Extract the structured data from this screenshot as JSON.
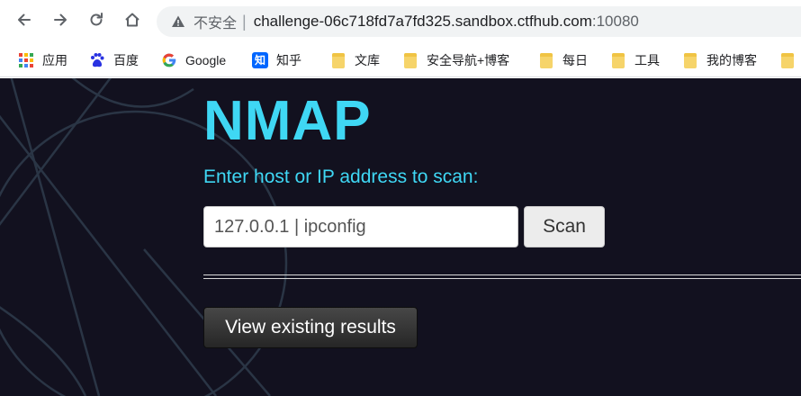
{
  "browser": {
    "nav": {
      "back_icon": "arrow-left-icon",
      "forward_icon": "arrow-right-icon",
      "reload_icon": "reload-icon",
      "home_icon": "home-icon"
    },
    "omnibox": {
      "security_icon": "warning-triangle-icon",
      "security_label": "不安全",
      "separator": "|",
      "url_host": "challenge-06c718fd7a7fd325.sandbox.ctfhub.com",
      "url_port": ":10080"
    },
    "bookmarks": [
      {
        "label": "应用",
        "icon": "apps-grid-icon"
      },
      {
        "label": "百度",
        "icon": "baidu-paw-icon"
      },
      {
        "label": "Google",
        "icon": "google-g-icon"
      },
      {
        "label": "知乎",
        "icon": "zhihu-icon",
        "icon_text": "知"
      },
      {
        "label": "文库",
        "icon": "folder-icon"
      },
      {
        "label": "安全导航+博客",
        "icon": "folder-icon"
      },
      {
        "label": "每日",
        "icon": "folder-icon"
      },
      {
        "label": "工具",
        "icon": "folder-icon"
      },
      {
        "label": "我的博客",
        "icon": "folder-icon"
      }
    ]
  },
  "page": {
    "title": "NMAP",
    "prompt": "Enter host or IP address to scan:",
    "host_input_value": "127.0.0.1 | ipconfig",
    "scan_button": "Scan",
    "results_button": "View existing results"
  },
  "colors": {
    "page_background": "#12111f",
    "accent": "#3fd7f4",
    "decor_lines": "#2a3545",
    "omnibox_background": "#f1f3f4"
  }
}
